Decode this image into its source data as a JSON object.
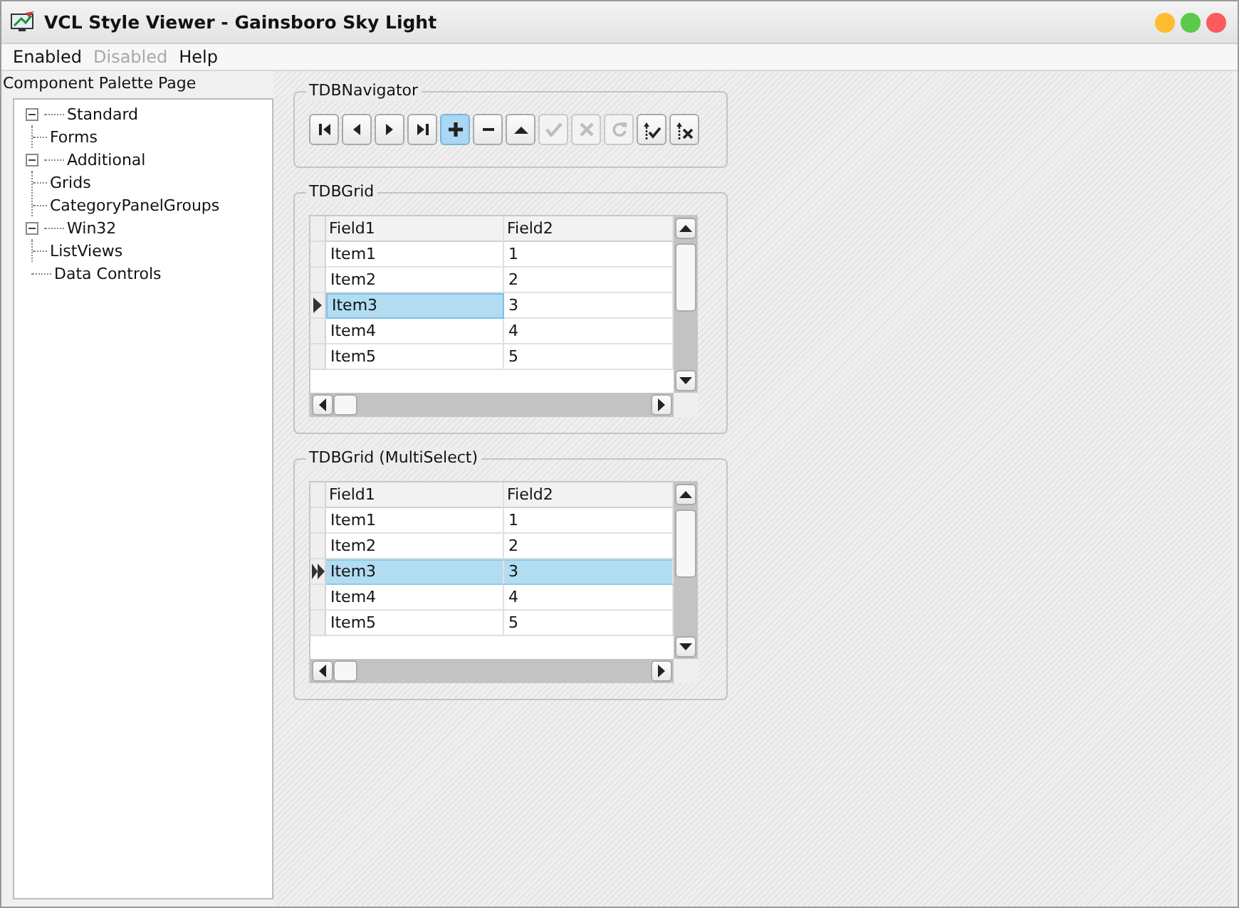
{
  "window": {
    "title": "VCL Style Viewer - Gainsboro Sky Light",
    "controls": [
      {
        "color": "#fdbd2f"
      },
      {
        "color": "#5bc94a"
      },
      {
        "color": "#fb5b5b"
      }
    ]
  },
  "menu": [
    {
      "label": "Enabled",
      "disabled": false
    },
    {
      "label": "Disabled",
      "disabled": true
    },
    {
      "label": "Help",
      "disabled": false
    }
  ],
  "sidebar": {
    "title": "Component Palette Page",
    "tree": [
      {
        "label": "Standard",
        "expanded": true,
        "children": [
          {
            "label": "Forms"
          }
        ]
      },
      {
        "label": "Additional",
        "expanded": true,
        "children": [
          {
            "label": "Grids"
          },
          {
            "label": "CategoryPanelGroups"
          }
        ]
      },
      {
        "label": "Win32",
        "expanded": true,
        "children": [
          {
            "label": "ListViews"
          }
        ]
      },
      {
        "label": "Data Controls"
      }
    ]
  },
  "navigator": {
    "title": "TDBNavigator",
    "buttons": [
      {
        "kind": "first",
        "selected": false,
        "disabled": false
      },
      {
        "kind": "prior",
        "selected": false,
        "disabled": false
      },
      {
        "kind": "next",
        "selected": false,
        "disabled": false
      },
      {
        "kind": "last",
        "selected": false,
        "disabled": false
      },
      {
        "kind": "insert",
        "selected": true,
        "disabled": false
      },
      {
        "kind": "delete",
        "selected": false,
        "disabled": false
      },
      {
        "kind": "edit",
        "selected": false,
        "disabled": false
      },
      {
        "kind": "post",
        "selected": false,
        "disabled": true
      },
      {
        "kind": "cancel",
        "selected": false,
        "disabled": true
      },
      {
        "kind": "refresh",
        "selected": false,
        "disabled": true
      },
      {
        "kind": "apply",
        "selected": false,
        "disabled": false
      },
      {
        "kind": "cancel_updates",
        "selected": false,
        "disabled": false
      }
    ]
  },
  "grids": [
    {
      "title": "TDBGrid",
      "multi_select": false,
      "columns": [
        "Field1",
        "Field2"
      ],
      "rows": [
        {
          "cells": [
            "Item1",
            "1"
          ],
          "selected": false
        },
        {
          "cells": [
            "Item2",
            "2"
          ],
          "selected": false
        },
        {
          "cells": [
            "Item3",
            "3"
          ],
          "selected": true
        },
        {
          "cells": [
            "Item4",
            "4"
          ],
          "selected": false
        },
        {
          "cells": [
            "Item5",
            "5"
          ],
          "selected": false
        }
      ]
    },
    {
      "title": "TDBGrid (MultiSelect)",
      "multi_select": true,
      "columns": [
        "Field1",
        "Field2"
      ],
      "rows": [
        {
          "cells": [
            "Item1",
            "1"
          ],
          "selected": false
        },
        {
          "cells": [
            "Item2",
            "2"
          ],
          "selected": false
        },
        {
          "cells": [
            "Item3",
            "3"
          ],
          "selected": true
        },
        {
          "cells": [
            "Item4",
            "4"
          ],
          "selected": false
        },
        {
          "cells": [
            "Item5",
            "5"
          ],
          "selected": false
        }
      ]
    }
  ]
}
